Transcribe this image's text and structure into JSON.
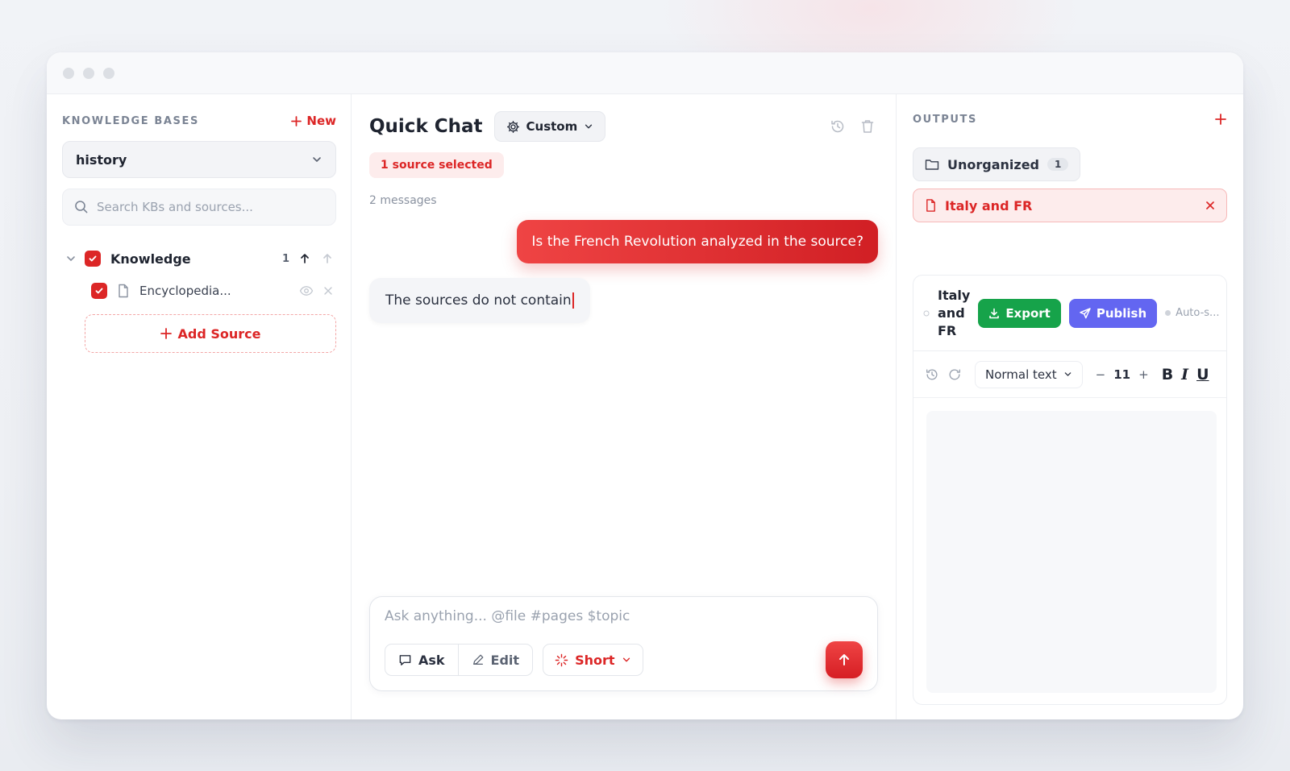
{
  "left": {
    "section_title": "KNOWLEDGE BASES",
    "new_label": "New",
    "kb_select_value": "history",
    "search_placeholder": "Search KBs and sources...",
    "kb_name": "Knowledge",
    "kb_count": "1",
    "source_name": "Encyclopedia...",
    "add_source_label": "Add Source"
  },
  "center": {
    "title": "Quick Chat",
    "mode_label": "Custom",
    "source_badge": "1 source selected",
    "message_count": "2 messages",
    "user_message": "Is the French Revolution analyzed in the source?",
    "bot_message": "The sources do not contain",
    "composer_placeholder": "Ask anything... @file #pages $topic",
    "ask_label": "Ask",
    "edit_label": "Edit",
    "length_label": "Short"
  },
  "right": {
    "section_title": "OUTPUTS",
    "folder_name": "Unorganized",
    "folder_count": "1",
    "doc_tab_name": "Italy and FR",
    "doc_title": "Italy and FR",
    "export_label": "Export",
    "publish_label": "Publish",
    "autosave_label": "Auto-s...",
    "text_style": "Normal text",
    "font_size": "11",
    "bold_label": "B",
    "italic_label": "I",
    "underline_label": "U"
  },
  "colors": {
    "accent": "#dc2626",
    "export": "#16a34a",
    "publish": "#6366f1"
  }
}
